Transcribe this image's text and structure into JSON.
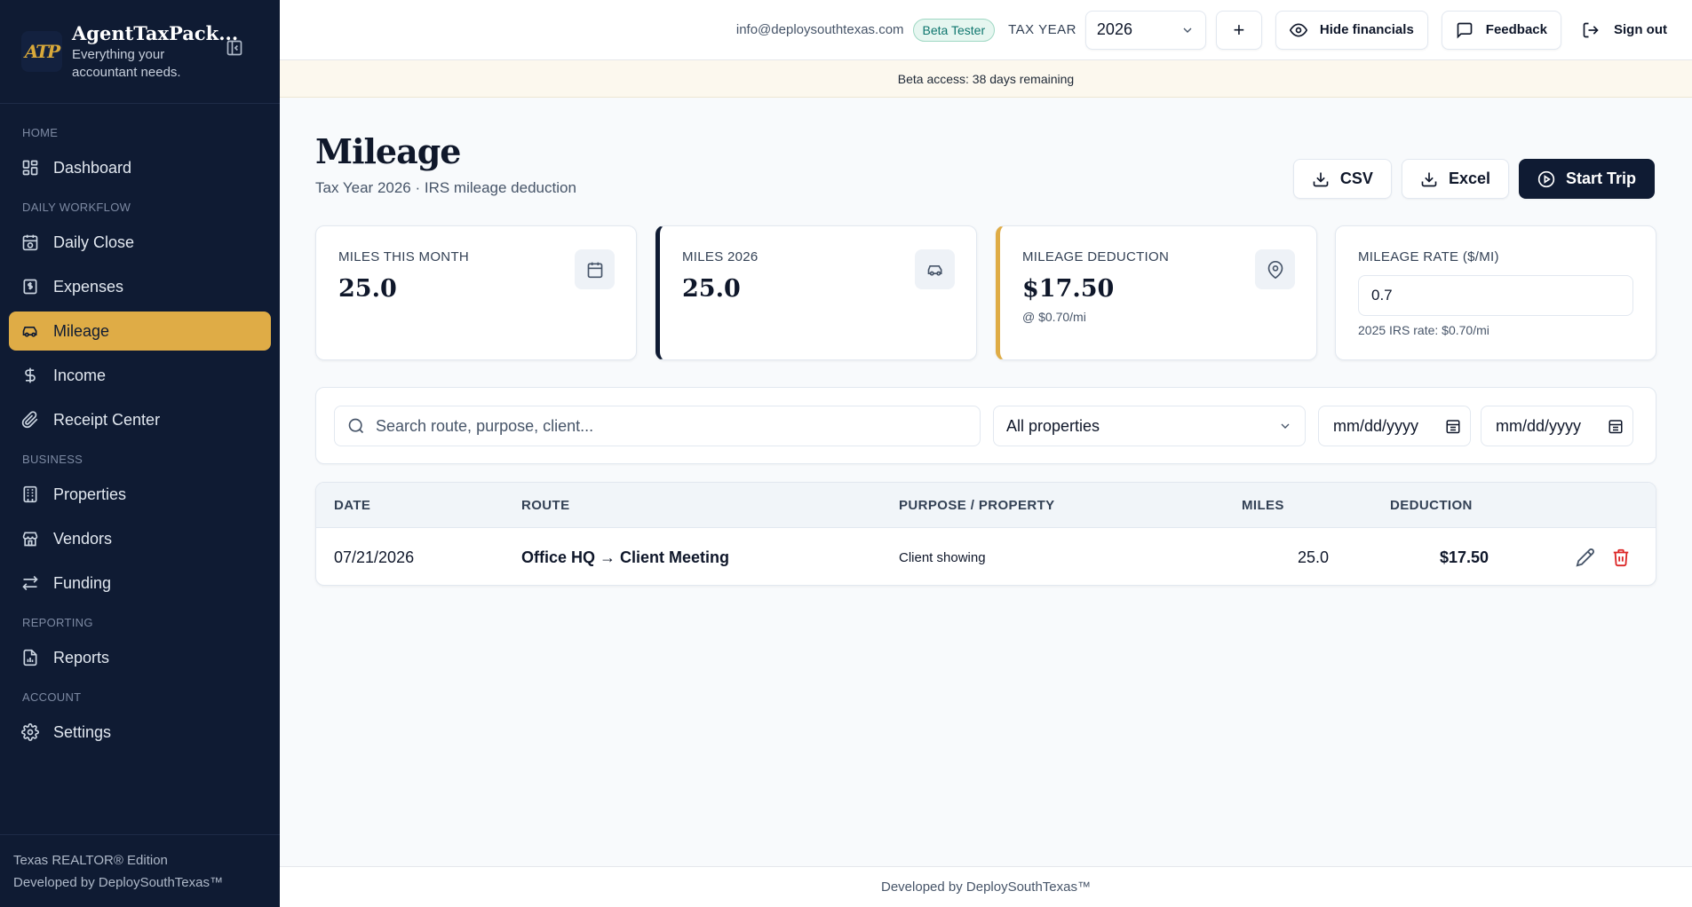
{
  "brand": {
    "logo_text": "ATP",
    "title": "AgentTaxPack...",
    "subtitle_line1": "Everything your",
    "subtitle_line2": "accountant needs."
  },
  "sidebar": {
    "sections": {
      "home": "HOME",
      "daily": "DAILY WORKFLOW",
      "business": "BUSINESS",
      "reporting": "REPORTING",
      "account": "ACCOUNT"
    },
    "items": [
      {
        "label": "Dashboard",
        "icon": "dashboard-icon"
      },
      {
        "label": "Daily Close",
        "icon": "calendar-check-icon"
      },
      {
        "label": "Expenses",
        "icon": "receipt-icon"
      },
      {
        "label": "Mileage",
        "icon": "car-icon",
        "active": true
      },
      {
        "label": "Income",
        "icon": "dollar-icon"
      },
      {
        "label": "Receipt Center",
        "icon": "paperclip-icon"
      },
      {
        "label": "Properties",
        "icon": "building-icon"
      },
      {
        "label": "Vendors",
        "icon": "store-icon"
      },
      {
        "label": "Funding",
        "icon": "transfer-icon"
      },
      {
        "label": "Reports",
        "icon": "report-icon"
      },
      {
        "label": "Settings",
        "icon": "gear-icon"
      }
    ],
    "footer_line1": "Texas REALTOR® Edition",
    "footer_line2": "Developed by DeploySouthTexas™"
  },
  "topbar": {
    "email": "info@deploysouthtexas.com",
    "badge": "Beta Tester",
    "tax_year_label": "TAX YEAR",
    "tax_year": "2026",
    "add_label": "+",
    "hide_financials": "Hide financials",
    "feedback": "Feedback",
    "sign_out": "Sign out"
  },
  "beta_notice": "Beta access: 38 days remaining",
  "page": {
    "title": "Mileage",
    "subtitle": "Tax Year 2026 · IRS mileage deduction",
    "actions": {
      "csv": "CSV",
      "excel": "Excel",
      "start_trip": "Start Trip"
    }
  },
  "cards": {
    "month": {
      "label": "MILES THIS MONTH",
      "value": "25.0"
    },
    "year": {
      "label": "MILES 2026",
      "value": "25.0"
    },
    "deduction": {
      "label": "MILEAGE DEDUCTION",
      "value": "$17.50",
      "note": "@ $0.70/mi"
    },
    "rate": {
      "label": "MILEAGE RATE ($/MI)",
      "input_value": "0.7",
      "note": "2025 IRS rate: $0.70/mi"
    }
  },
  "filters": {
    "search_placeholder": "Search route, purpose, client...",
    "property_selected": "All properties",
    "date_from": "mm/dd/yyyy",
    "date_to": "mm/dd/yyyy"
  },
  "table": {
    "headers": {
      "date": "DATE",
      "route": "ROUTE",
      "purpose": "PURPOSE / PROPERTY",
      "miles": "MILES",
      "deduction": "DEDUCTION"
    },
    "rows": [
      {
        "date": "07/21/2026",
        "route": "Office HQ → Client Meeting",
        "purpose": "Client showing",
        "miles": "25.0",
        "deduction": "$17.50"
      }
    ]
  },
  "footer": "Developed by DeploySouthTexas™",
  "colors": {
    "navy": "#0f1b33",
    "gold": "#dfac46",
    "danger": "#dc2626",
    "badge_green": "#0f766e"
  }
}
